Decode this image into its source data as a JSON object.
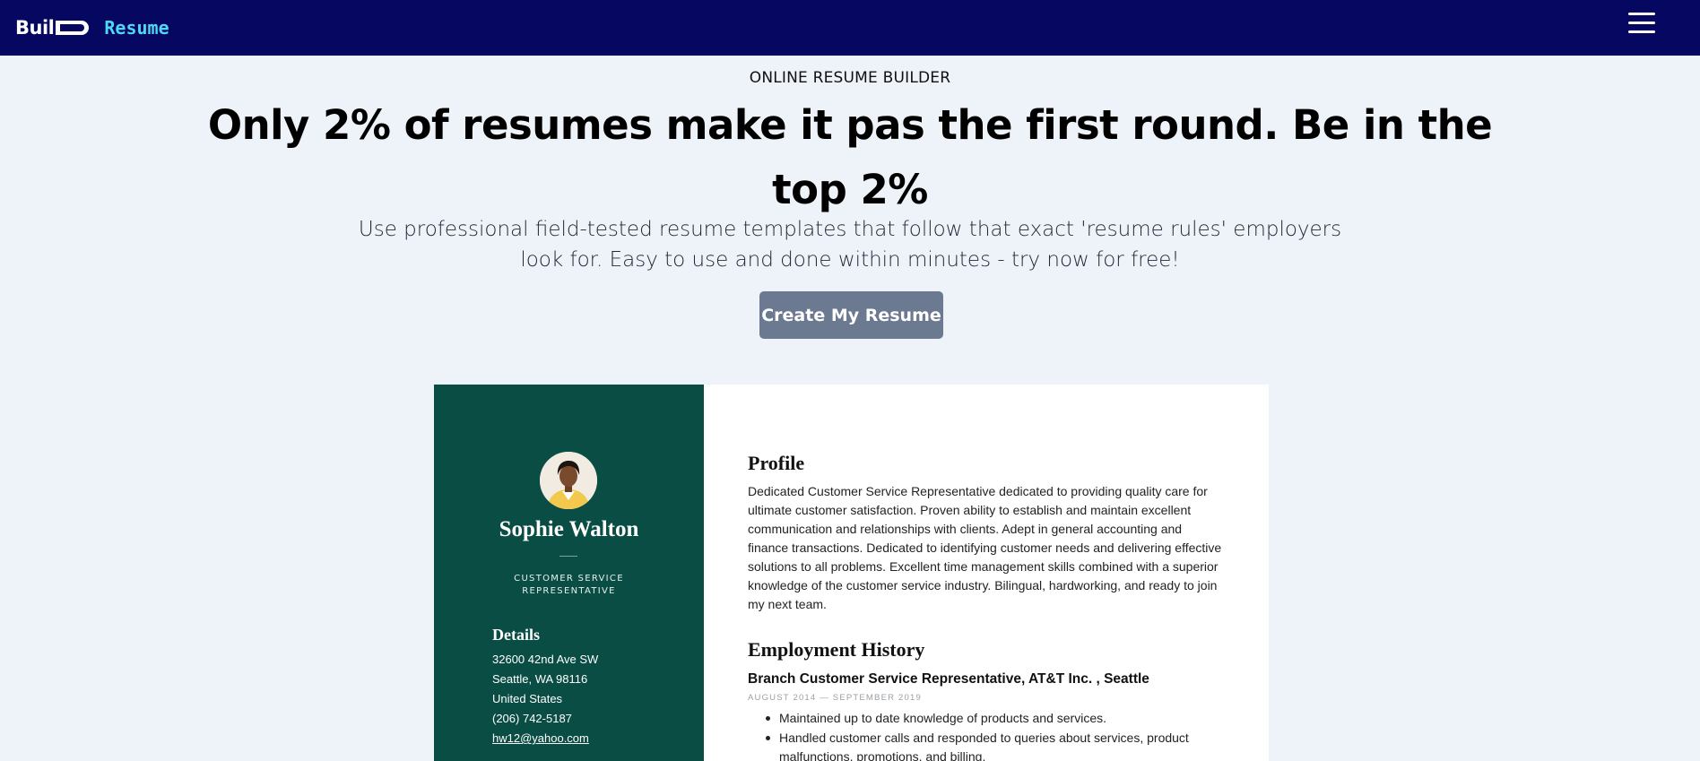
{
  "brand": {
    "logo_word": "Buil",
    "logo_suffix": "Resume",
    "accent_color": "#4fd8f5",
    "navbar_color": "#050761",
    "menu_icon": "hamburger-menu-icon"
  },
  "hero": {
    "eyebrow": "ONLINE RESUME BUILDER",
    "headline": "Only 2% of resumes make it pas the first round. Be in the top 2%",
    "subtext": "Use professional field-tested resume templates that follow that exact 'resume rules' employers look for. Easy to use and done within minutes - try now for free!",
    "cta_label": "Create My Resume",
    "cta_color": "#6b7a91"
  },
  "resume_preview": {
    "sidebar_color": "#0a4d44",
    "name": "Sophie Walton",
    "job_title": "CUSTOMER SERVICE REPRESENTATIVE",
    "details_heading": "Details",
    "details": {
      "address_line1": "32600 42nd Ave SW",
      "address_line2": "Seattle, WA 98116",
      "country": "United States",
      "phone": "(206) 742-5187",
      "email": "hw12@yahoo.com"
    },
    "profile_heading": "Profile",
    "profile_text": "Dedicated Customer Service Representative dedicated to providing quality care for ultimate customer satisfaction. Proven ability to establish and maintain excellent communication and relationships with clients. Adept in general accounting and finance transactions. Dedicated to identifying customer needs and delivering effective solutions to all problems. Excellent time management skills combined with a superior knowledge of the customer service industry. Bilingual, hardworking, and ready to join my next team.",
    "employment_heading": "Employment History",
    "jobs": [
      {
        "title": "Branch Customer Service Representative, AT&T Inc. , Seattle",
        "dates": "AUGUST 2014 — SEPTEMBER 2019",
        "bullets": [
          "Maintained up to date knowledge of products and services.",
          "Handled customer calls and responded to queries about services, product malfunctions, promotions, and billing."
        ]
      }
    ]
  }
}
